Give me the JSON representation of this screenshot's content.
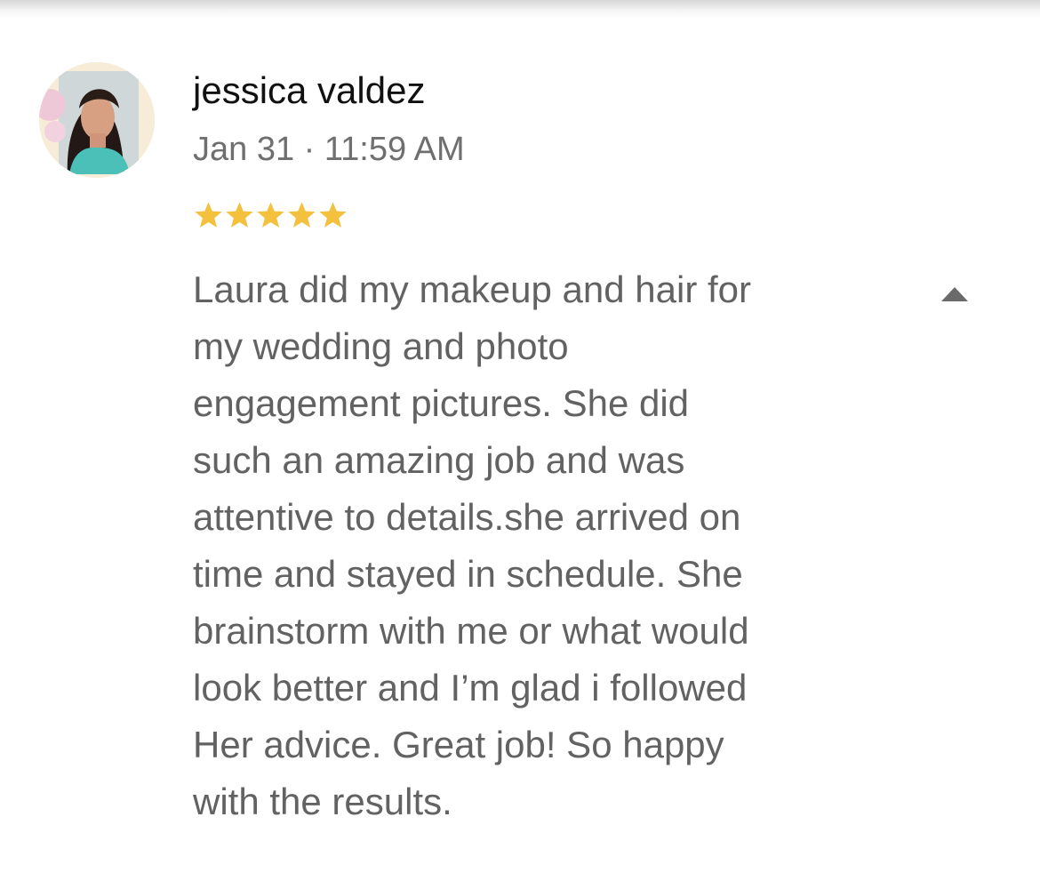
{
  "review": {
    "reviewer_name": "jessica valdez",
    "date_time": "Jan 31 · 11:59 AM",
    "rating": 5,
    "rating_max": 5,
    "text": "Laura did my makeup and hair for\nmy wedding and photo\nengagement pictures. She did\nsuch an amazing job and was\nattentive to details.she arrived on\ntime and stayed in schedule. She\nbrainstorm with me or what would\nlook better and I’m glad i followed\nHer advice. Great job! So happy\nwith the results.",
    "expanded": true
  },
  "icons": {
    "star": "star-icon",
    "toggle": "collapse-triangle-icon"
  },
  "colors": {
    "star": "#F4C13F",
    "name": "#111111",
    "meta": "#6F6F6F",
    "body": "#626262",
    "toggle": "#6A6A6A"
  }
}
